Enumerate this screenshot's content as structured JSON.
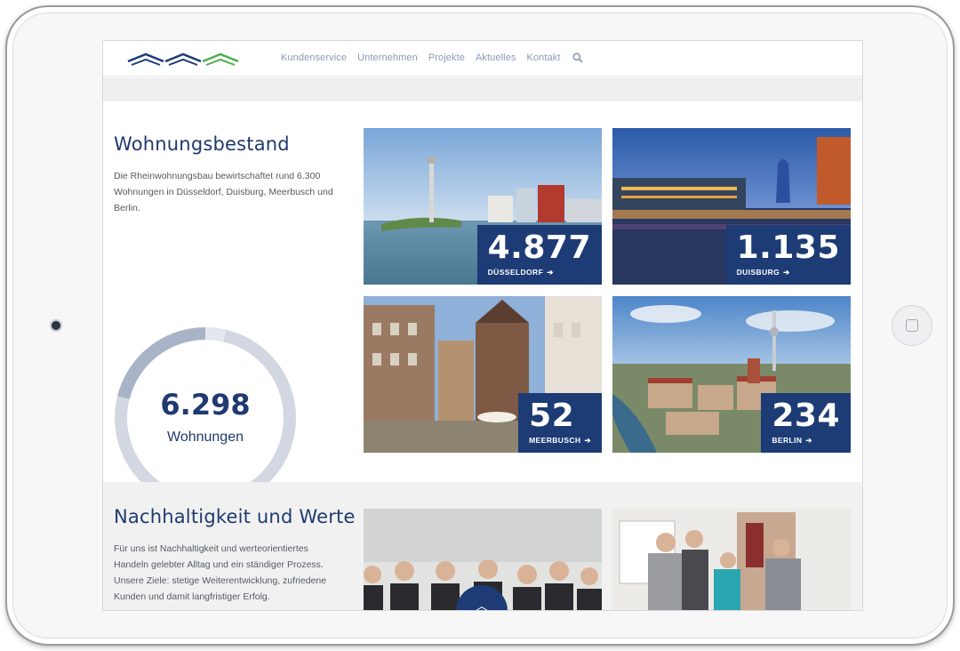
{
  "nav": {
    "items": [
      "Kundenservice",
      "Unternehmen",
      "Projekte",
      "Aktuelles",
      "Kontakt"
    ],
    "search_icon": "search-icon"
  },
  "bestand": {
    "title": "Wohnungsbestand",
    "text_lines": [
      "Die Rheinwohnungsbau bewirtschaftet rund 6.300",
      "Wohnungen in Düsseldorf, Duisburg, Meerbusch und",
      "Berlin."
    ],
    "total_value": "6.298",
    "total_label": "Wohnungen",
    "cities": [
      {
        "count": "4.877",
        "name": "DÜSSELDORF"
      },
      {
        "count": "1.135",
        "name": "DUISBURG"
      },
      {
        "count": "52",
        "name": "MEERBUSCH"
      },
      {
        "count": "234",
        "name": "BERLIN"
      }
    ]
  },
  "nachhaltigkeit": {
    "title": "Nachhaltigkeit und Werte",
    "text_lines": [
      "Für uns ist Nachhaltigkeit und werteorientiertes",
      "Handeln gelebter Alltag und ein ständiger Prozess.",
      "Unsere Ziele: stetige Weiterentwicklung, zufriedene",
      "Kunden und damit langfristiger Erfolg."
    ]
  },
  "colors": {
    "brand_blue": "#1d3b75",
    "logo_green": "#4caf50",
    "nav_text": "#8a9ab8"
  }
}
